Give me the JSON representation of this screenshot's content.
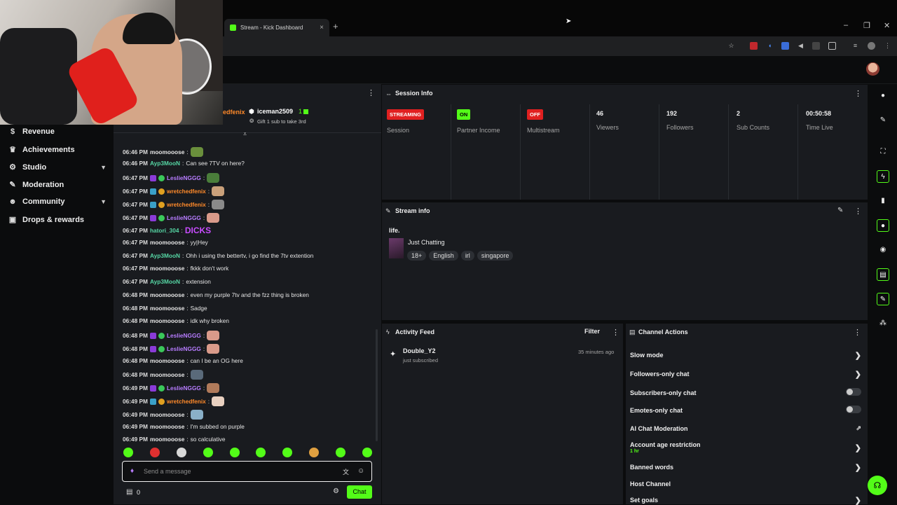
{
  "browser": {
    "tab_title": "Stream - Kick Dashboard",
    "new_tab": "+",
    "close_tab": "×",
    "minimize": "–",
    "restore": "❐",
    "close": "✕"
  },
  "sidebar": {
    "items": [
      {
        "label": "Revenue",
        "icon": "dollar-icon"
      },
      {
        "label": "Achievements",
        "icon": "trophy-icon"
      },
      {
        "label": "Studio",
        "icon": "gear-icon",
        "expandable": true
      },
      {
        "label": "Moderation",
        "icon": "wrench-icon"
      },
      {
        "label": "Community",
        "icon": "users-icon",
        "expandable": true
      },
      {
        "label": "Drops & rewards",
        "icon": "gift-icon"
      }
    ]
  },
  "chat": {
    "pinned_user_partial": "edfenix",
    "gifter": "iceman2509",
    "gift_count": "1",
    "gift_text": "Gift 1 sub to take 3rd",
    "messages": [
      {
        "time": "06:46 PM",
        "user": "moomooose",
        "text": "",
        "color": "#e6e6e6",
        "emote": "#6a8f3c"
      },
      {
        "time": "06:46 PM",
        "user": "Ayp3MooN",
        "text": "Can see 7TV on here?",
        "color": "#56d6a4"
      },
      {
        "time": "06:47 PM",
        "user": "LeslieNGGG",
        "text": "",
        "color": "#b77cff",
        "emote": "#4a7d3a"
      },
      {
        "time": "06:47 PM",
        "user": "wretchedfenix",
        "text": "",
        "color": "#ff8a2a",
        "emote": "#c9a07a"
      },
      {
        "time": "06:47 PM",
        "user": "wretchedfenix",
        "text": "",
        "color": "#ff8a2a",
        "emote": "#8a8a8a"
      },
      {
        "time": "06:47 PM",
        "user": "LeslieNGGG",
        "text": "",
        "color": "#b77cff",
        "emote": "#d99a8a"
      },
      {
        "time": "06:47 PM",
        "user": "hatori_304",
        "text": "DICKS",
        "color": "#56d6a4"
      },
      {
        "time": "06:47 PM",
        "user": "moomooose",
        "text": "yy|Hey",
        "color": "#e6e6e6"
      },
      {
        "time": "06:47 PM",
        "user": "Ayp3MooN",
        "text": "Ohh i using the bettertv, i go find the 7tv extention",
        "color": "#56d6a4"
      },
      {
        "time": "06:47 PM",
        "user": "moomooose",
        "text": "fkkk don't work",
        "color": "#e6e6e6"
      },
      {
        "time": "06:47 PM",
        "user": "Ayp3MooN",
        "text": "extension",
        "color": "#56d6a4"
      },
      {
        "time": "06:48 PM",
        "user": "moomooose",
        "text": "even my purple 7tv and the fzz thing is broken",
        "color": "#e6e6e6"
      },
      {
        "time": "06:48 PM",
        "user": "moomooose",
        "text": "Sadge",
        "color": "#e6e6e6"
      },
      {
        "time": "06:48 PM",
        "user": "moomooose",
        "text": "idk why broken",
        "color": "#e6e6e6"
      },
      {
        "time": "06:48 PM",
        "user": "LeslieNGGG",
        "text": "",
        "color": "#b77cff",
        "emote": "#d99a8a"
      },
      {
        "time": "06:48 PM",
        "user": "LeslieNGGG",
        "text": "",
        "color": "#b77cff",
        "emote": "#d99a8a"
      },
      {
        "time": "06:48 PM",
        "user": "moomooose",
        "text": "can I be an OG here",
        "color": "#e6e6e6"
      },
      {
        "time": "06:48 PM",
        "user": "moomooose",
        "text": "",
        "color": "#e6e6e6",
        "emote": "#5a6a7a"
      },
      {
        "time": "06:49 PM",
        "user": "LeslieNGGG",
        "text": "",
        "color": "#b77cff",
        "emote": "#b07a5a"
      },
      {
        "time": "06:49 PM",
        "user": "wretchedfenix",
        "text": "",
        "color": "#ff8a2a",
        "emote": "#e8d0c0"
      },
      {
        "time": "06:49 PM",
        "user": "moomooose",
        "text": "",
        "color": "#e6e6e6",
        "emote": "#8ab0c8"
      },
      {
        "time": "06:49 PM",
        "user": "moomooose",
        "text": "I'm subbed on purple",
        "color": "#e6e6e6"
      },
      {
        "time": "06:49 PM",
        "user": "moomooose",
        "text": "so calculative",
        "color": "#e6e6e6"
      }
    ],
    "input_placeholder": "Send a message",
    "points": "0",
    "send_label": "Chat"
  },
  "session": {
    "title": "Session Info",
    "statuses": [
      {
        "badge": "STREAMING",
        "label": "Session",
        "bg": "#e02020",
        "fg": "#ffffff"
      },
      {
        "badge": "ON",
        "label": "Partner Income",
        "bg": "#53fc18",
        "fg": "#000000"
      },
      {
        "badge": "OFF",
        "label": "Multistream",
        "bg": "#e02020",
        "fg": "#ffffff"
      }
    ],
    "stats": [
      {
        "value": "46",
        "label": "Viewers"
      },
      {
        "value": "192",
        "label": "Followers"
      },
      {
        "value": "2",
        "label": "Sub Counts"
      },
      {
        "value": "00:50:58",
        "label": "Time Live"
      }
    ]
  },
  "stream_info": {
    "title": "Stream info",
    "stream_title": "life.",
    "category": "Just Chatting",
    "tags": [
      "18+",
      "English",
      "irl",
      "singapore"
    ]
  },
  "activity": {
    "title": "Activity Feed",
    "filter_label": "Filter",
    "items": [
      {
        "user": "Double_Y2",
        "action": "just subscribed",
        "time": "35 minutes ago"
      }
    ]
  },
  "channel_actions": {
    "title": "Channel Actions",
    "items": [
      {
        "label": "Slow mode",
        "control": "chevron"
      },
      {
        "label": "Followers-only chat",
        "control": "chevron"
      },
      {
        "label": "Subscribers-only chat",
        "control": "toggle"
      },
      {
        "label": "Emotes-only chat",
        "control": "toggle"
      },
      {
        "label": "AI Chat Moderation",
        "control": "external"
      },
      {
        "label": "Account age restriction",
        "sub": "1 hr",
        "control": "chevron"
      },
      {
        "label": "Banned words",
        "control": "chevron"
      },
      {
        "label": "Host Channel",
        "control": "none"
      },
      {
        "label": "Set goals",
        "control": "chevron"
      }
    ]
  },
  "colors": {
    "accent": "#53fc18",
    "panel": "#191b1f",
    "background": "#0b0c0d"
  }
}
